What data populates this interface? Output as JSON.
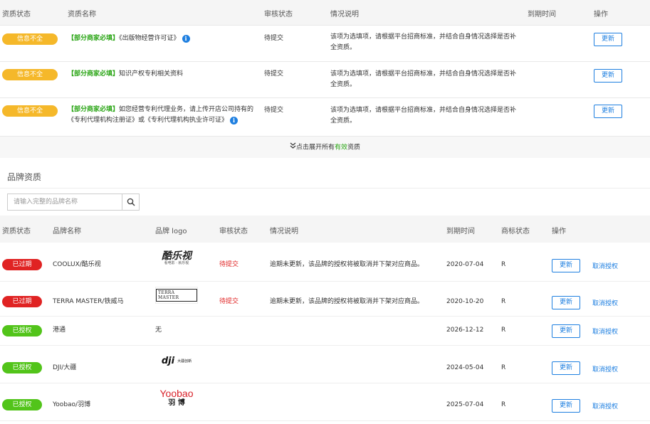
{
  "qualification": {
    "headers": {
      "status": "资质状态",
      "name": "资质名称",
      "audit": "审核状态",
      "desc": "情况说明",
      "expire": "到期时间",
      "action": "操作"
    },
    "rows": [
      {
        "badge": "信息不全",
        "tag": "【部分商家必填】",
        "name": "《出版物经营许可证》",
        "audit": "待提交",
        "desc": "该项为选填项，请根据平台招商标准，并结合自身情况选择是否补全资质。",
        "action": "更新"
      },
      {
        "badge": "信息不全",
        "tag": "【部分商家必填】",
        "name": "知识产权专利相关资料",
        "audit": "待提交",
        "desc": "该项为选填项，请根据平台招商标准，并结合自身情况选择是否补全资质。",
        "action": "更新"
      },
      {
        "badge": "信息不全",
        "tag": "【部分商家必填】",
        "name": "如您经营专利代理业务，请上传开店公司持有的《专利代理机构注册证》或《专利代理机构执业许可证》",
        "audit": "待提交",
        "desc": "该项为选填项，请根据平台招商标准，并结合自身情况选择是否补全资质。",
        "action": "更新"
      }
    ]
  },
  "expand": {
    "icon": "double-chevron-down",
    "prefix": "点击展开所有",
    "highlight": "有效",
    "suffix": "资质"
  },
  "brand_section": {
    "title": "品牌资质",
    "search_placeholder": "请输入完整的品牌名称",
    "headers": {
      "status": "资质状态",
      "name": "品牌名称",
      "logo": "品牌 logo",
      "audit": "审核状态",
      "desc": "情况说明",
      "expire": "到期时间",
      "tm": "商标状态",
      "action": "操作"
    },
    "rows": [
      {
        "badge": "已过期",
        "badge_type": "expired",
        "name": "COOLUX/酷乐视",
        "logo_main": "酷乐视",
        "logo_sub": "看电影 · 就乐视",
        "audit": "待提交",
        "desc": "逾期未更新，该品牌的授权将被取消并下架对应商品。",
        "expire": "2020-07-04",
        "tm": "R",
        "update": "更新",
        "cancel": "取消授权"
      },
      {
        "badge": "已过期",
        "badge_type": "expired",
        "name": "TERRA MASTER/铁威马",
        "logo_main": "TERRA MASTER",
        "audit": "待提交",
        "desc": "逾期未更新，该品牌的授权将被取消并下架对应商品。",
        "expire": "2020-10-20",
        "tm": "R",
        "update": "更新",
        "cancel": "取消授权"
      },
      {
        "badge": "已授权",
        "badge_type": "ok",
        "name": "港通",
        "logo_text": "无",
        "audit": "",
        "desc": "",
        "expire": "2026-12-12",
        "tm": "R",
        "update": "更新",
        "cancel": "取消授权"
      },
      {
        "badge": "已授权",
        "badge_type": "ok",
        "name": "DJI/大疆",
        "logo_main": "dji",
        "logo_sub": "大疆创新",
        "audit": "",
        "desc": "",
        "expire": "2024-05-04",
        "tm": "R",
        "update": "更新",
        "cancel": "取消授权"
      },
      {
        "badge": "已授权",
        "badge_type": "ok",
        "name": "Yoobao/羽博",
        "logo_main": "Yoobao",
        "logo_sub": "羽 博",
        "audit": "",
        "desc": "",
        "expire": "2025-07-04",
        "tm": "R",
        "update": "更新",
        "cancel": "取消授权"
      }
    ]
  },
  "colors": {
    "warn": "#f5b82a",
    "expired": "#e02323",
    "ok": "#52c41a",
    "link": "#1e7fe0",
    "required_tag": "#2aa515"
  }
}
